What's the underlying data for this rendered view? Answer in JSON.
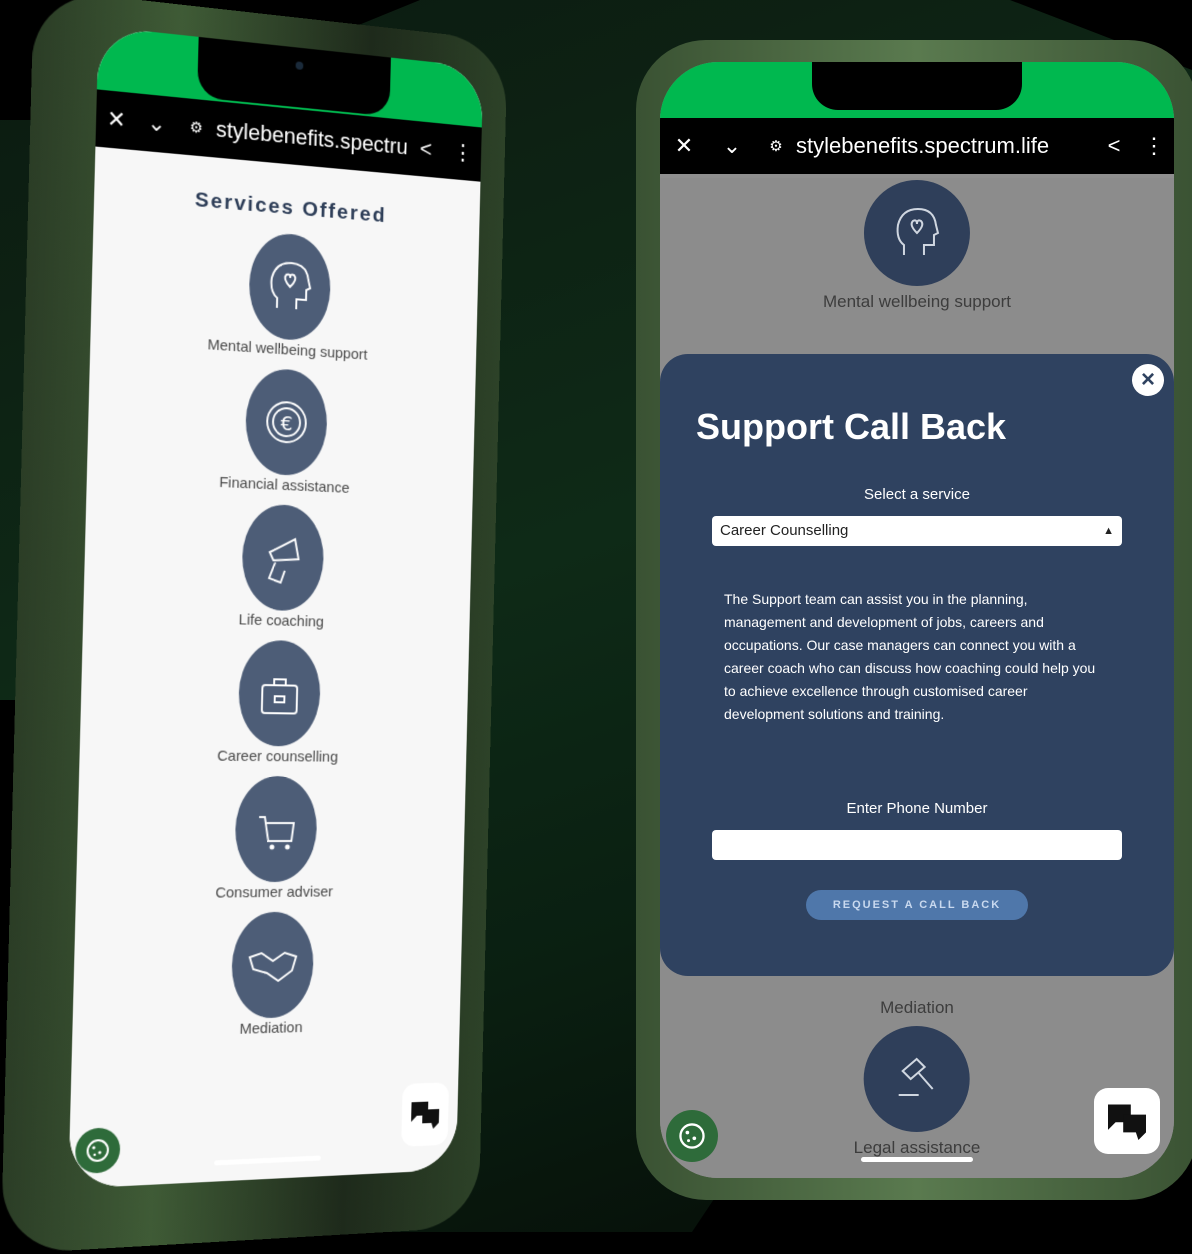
{
  "browser": {
    "url": "stylebenefits.spectrum.life",
    "close_icon": "close-icon",
    "menu_icon": "kebab-menu-icon"
  },
  "left_screen": {
    "title": "Services Offered",
    "services": [
      {
        "label": "Mental wellbeing support",
        "icon": "head-heart-icon"
      },
      {
        "label": "Financial assistance",
        "icon": "euro-coin-icon"
      },
      {
        "label": "Life coaching",
        "icon": "megaphone-icon"
      },
      {
        "label": "Career counselling",
        "icon": "briefcase-icon"
      },
      {
        "label": "Consumer adviser",
        "icon": "shopping-cart-icon"
      },
      {
        "label": "Mediation",
        "icon": "handshake-icon"
      }
    ]
  },
  "right_screen": {
    "bg_services": {
      "top": "Mental wellbeing support",
      "mid": "Mediation",
      "bottom": "Legal assistance"
    },
    "modal": {
      "title": "Support Call Back",
      "select_label": "Select a service",
      "selected_service": "Career Counselling",
      "description": "The Support team can assist you in the planning, management and development of jobs, careers and occupations. Our case managers can connect you with a career coach who can discuss how coaching could help you to achieve excellence through customised career development solutions and training.",
      "phone_label": "Enter Phone Number",
      "phone_value": "",
      "button": "REQUEST A CALL BACK"
    }
  },
  "colors": {
    "status_green": "#00b84f",
    "modal_bg": "#2f4260",
    "icon_circle": "#4d5d77",
    "cta": "#4f77aa"
  }
}
